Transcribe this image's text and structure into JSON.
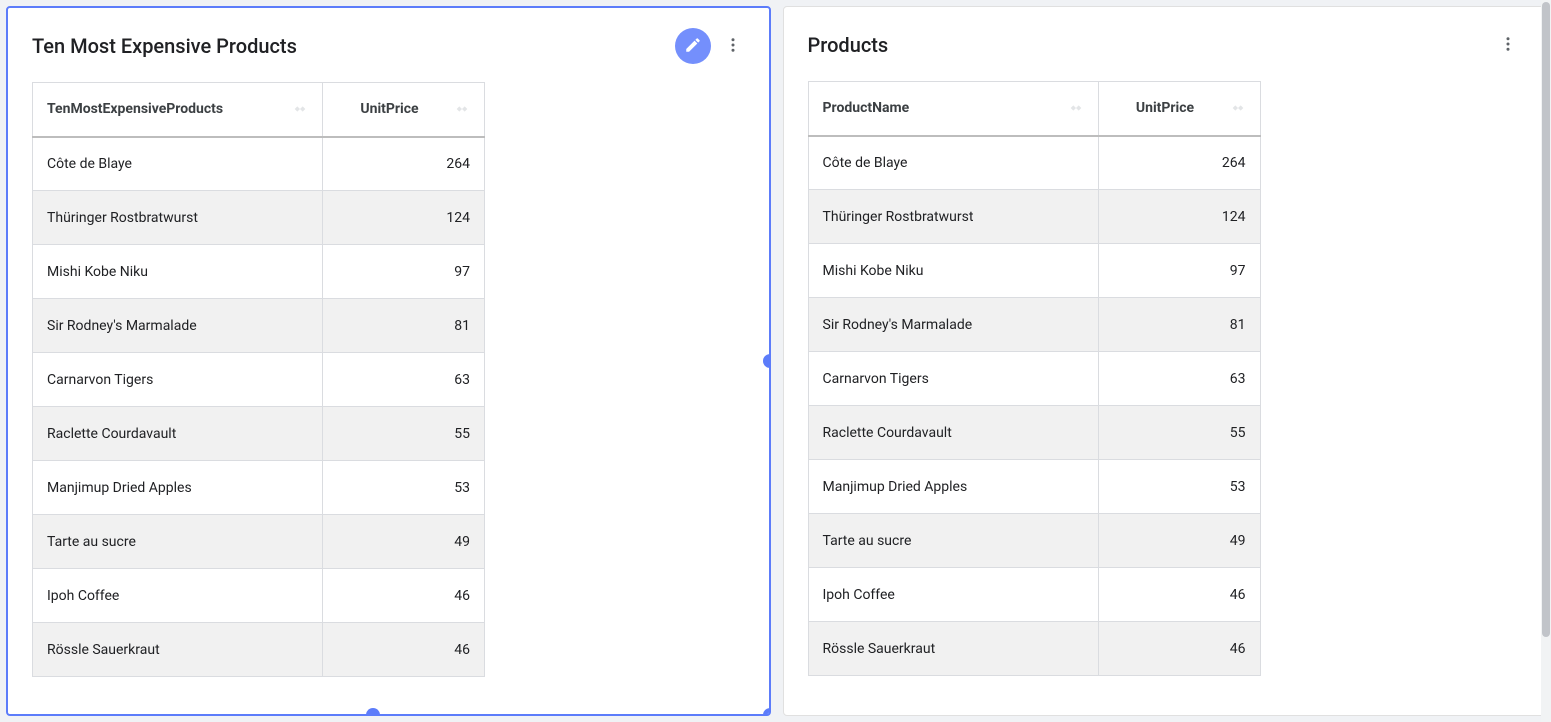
{
  "panels": [
    {
      "title": "Ten Most Expensive Products",
      "selected": true,
      "showEdit": true,
      "columns": [
        {
          "key": "name",
          "label": "TenMostExpensiveProducts"
        },
        {
          "key": "price",
          "label": "UnitPrice"
        }
      ],
      "rows": [
        {
          "name": "Côte de Blaye",
          "price": "264"
        },
        {
          "name": "Thüringer Rostbratwurst",
          "price": "124"
        },
        {
          "name": "Mishi Kobe Niku",
          "price": "97"
        },
        {
          "name": "Sir Rodney's Marmalade",
          "price": "81"
        },
        {
          "name": "Carnarvon Tigers",
          "price": "63"
        },
        {
          "name": "Raclette Courdavault",
          "price": "55"
        },
        {
          "name": "Manjimup Dried Apples",
          "price": "53"
        },
        {
          "name": "Tarte au sucre",
          "price": "49"
        },
        {
          "name": "Ipoh Coffee",
          "price": "46"
        },
        {
          "name": "Rössle Sauerkraut",
          "price": "46"
        }
      ]
    },
    {
      "title": "Products",
      "selected": false,
      "showEdit": false,
      "columns": [
        {
          "key": "name",
          "label": "ProductName"
        },
        {
          "key": "price",
          "label": "UnitPrice"
        }
      ],
      "rows": [
        {
          "name": "Côte de Blaye",
          "price": "264"
        },
        {
          "name": "Thüringer Rostbratwurst",
          "price": "124"
        },
        {
          "name": "Mishi Kobe Niku",
          "price": "97"
        },
        {
          "name": "Sir Rodney's Marmalade",
          "price": "81"
        },
        {
          "name": "Carnarvon Tigers",
          "price": "63"
        },
        {
          "name": "Raclette Courdavault",
          "price": "55"
        },
        {
          "name": "Manjimup Dried Apples",
          "price": "53"
        },
        {
          "name": "Tarte au sucre",
          "price": "49"
        },
        {
          "name": "Ipoh Coffee",
          "price": "46"
        },
        {
          "name": "Rössle Sauerkraut",
          "price": "46"
        }
      ]
    }
  ]
}
